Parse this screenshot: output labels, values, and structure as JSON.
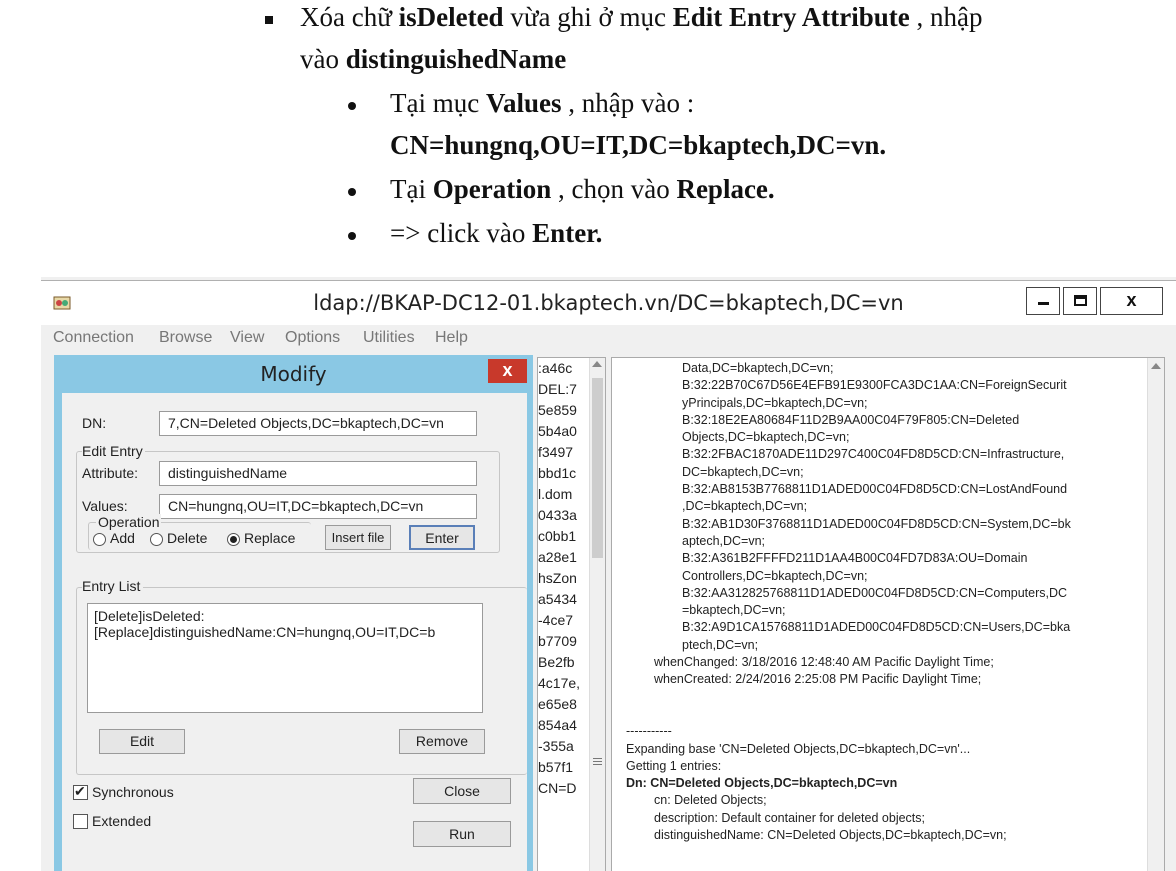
{
  "doc": {
    "line1_a": "Xóa chữ ",
    "line1_b": "isDeleted",
    "line1_c": " vừa ghi ở mục ",
    "line1_d": "Edit Entry Attribute",
    "line1_e": " , nhập",
    "line2_a": "vào ",
    "line2_b": "distinguishedName",
    "line3_a": "Tại mục ",
    "line3_b": "Values",
    "line3_c": " , nhập vào :",
    "line4": "CN=hungnq,OU=IT,DC=bkaptech,DC=vn.",
    "line5_a": "Tại ",
    "line5_b": "Operation",
    "line5_c": " , chọn vào ",
    "line5_d": "Replace.",
    "line6_a": "=> click vào ",
    "line6_b": "Enter."
  },
  "window": {
    "title": "ldap://BKAP-DC12-01.bkaptech.vn/DC=bkaptech,DC=vn",
    "minimize": "_",
    "maximize": "☐",
    "close": "x",
    "menu": [
      "Connection",
      "Browse",
      "View",
      "Options",
      "Utilities",
      "Help"
    ]
  },
  "dialog": {
    "title": "Modify",
    "close": "x",
    "dn_label": "DN:",
    "dn_value": "7,CN=Deleted Objects,DC=bkaptech,DC=vn",
    "edit_entry_label": "Edit Entry",
    "attribute_label": "Attribute:",
    "attribute_value": "distinguishedName",
    "values_label": "Values:",
    "values_value": "CN=hungnq,OU=IT,DC=bkaptech,DC=vn",
    "operation_label": "Operation",
    "op_add": "Add",
    "op_delete": "Delete",
    "op_replace": "Replace",
    "op_selected": "Replace",
    "insert_file": "Insert file",
    "enter": "Enter",
    "entry_list_label": "Entry List",
    "entry_list": [
      "[Delete]isDeleted:",
      "[Replace]distinguishedName:CN=hungnq,OU=IT,DC=b"
    ],
    "edit_button": "Edit",
    "remove_button": "Remove",
    "synchronous_label": "Synchronous",
    "synchronous_checked": true,
    "extended_label": "Extended",
    "extended_checked": false,
    "close_button": "Close",
    "run_button": "Run"
  },
  "tree": {
    "items": [
      ":a46c",
      "DEL:7",
      "5e859",
      "5b4a0",
      "f3497",
      "bbd1c",
      "l.dom",
      "0433a",
      "c0bb1",
      "a28e1",
      "hsZon",
      "a5434",
      "-4ce7",
      "b7709",
      "Be2fb",
      "4c17e,",
      "e65e8",
      "854a4",
      "-355a",
      "b57f1",
      "CN=D"
    ]
  },
  "output": {
    "lines": [
      "Data,DC=bkaptech,DC=vn;",
      "B:32:22B70C67D56E4EFB91E9300FCA3DC1AA:CN=ForeignSecurit",
      "yPrincipals,DC=bkaptech,DC=vn;",
      "B:32:18E2EA80684F11D2B9AA00C04F79F805:CN=Deleted",
      "Objects,DC=bkaptech,DC=vn;",
      "B:32:2FBAC1870ADE11D297C400C04FD8D5CD:CN=Infrastructure,",
      "DC=bkaptech,DC=vn;",
      "B:32:AB8153B7768811D1ADED00C04FD8D5CD:CN=LostAndFound",
      ",DC=bkaptech,DC=vn;",
      "B:32:AB1D30F3768811D1ADED00C04FD8D5CD:CN=System,DC=bk",
      "aptech,DC=vn;",
      "B:32:A361B2FFFFD211D1AA4B00C04FD7D83A:OU=Domain",
      "Controllers,DC=bkaptech,DC=vn;",
      "B:32:AA312825768811D1ADED00C04FD8D5CD:CN=Computers,DC",
      "=bkaptech,DC=vn;",
      "B:32:A9D1CA15768811D1ADED00C04FD8D5CD:CN=Users,DC=bka",
      "ptech,DC=vn;",
      "whenChanged: 3/18/2016 12:48:40 AM Pacific Daylight Time;",
      "whenCreated: 2/24/2016 2:25:08 PM Pacific Daylight Time;",
      "",
      "",
      "-----------",
      "Expanding base 'CN=Deleted Objects,DC=bkaptech,DC=vn'...",
      "Getting 1 entries:",
      "Dn: CN=Deleted Objects,DC=bkaptech,DC=vn",
      "cn: Deleted Objects;",
      "description: Default container for deleted objects;",
      "distinguishedName: CN=Deleted Objects,DC=bkaptech,DC=vn;"
    ]
  }
}
